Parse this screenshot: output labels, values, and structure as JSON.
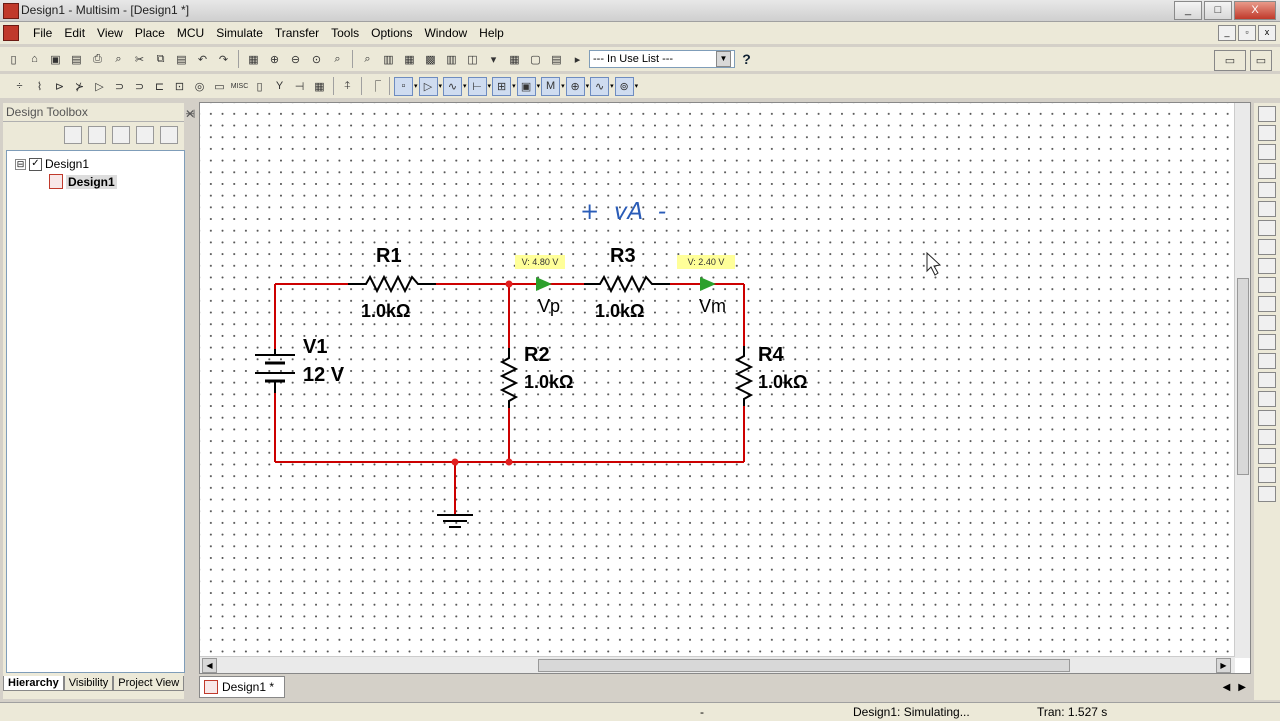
{
  "window": {
    "title": "Design1 - Multisim - [Design1 *]",
    "buttons": [
      "_",
      "□",
      "X"
    ]
  },
  "menu": {
    "items": [
      "File",
      "Edit",
      "View",
      "Place",
      "MCU",
      "Simulate",
      "Transfer",
      "Tools",
      "Options",
      "Window",
      "Help"
    ]
  },
  "toolbar": {
    "in_use_list": "--- In Use List ---",
    "help_symbol": "?",
    "misc_label": "MISC"
  },
  "toolbox": {
    "title": "Design Toolbox",
    "tree": [
      {
        "label": "Design1",
        "expand": "⊟",
        "checked": "✓"
      },
      {
        "label": "Design1",
        "selected": true
      }
    ],
    "tabs": [
      "Hierarchy",
      "Visibility",
      "Project View"
    ]
  },
  "schematic": {
    "annotation": "+  vA  -",
    "components": [
      {
        "ref": "R1",
        "value": "1.0kΩ"
      },
      {
        "ref": "R2",
        "value": "1.0kΩ"
      },
      {
        "ref": "R3",
        "value": "1.0kΩ"
      },
      {
        "ref": "R4",
        "value": "1.0kΩ"
      },
      {
        "ref": "V1",
        "value": "12 V"
      }
    ],
    "probes": [
      {
        "name": "Vp",
        "reading": "V: 4.80 V"
      },
      {
        "name": "Vm",
        "reading": "V: 2.40 V"
      }
    ],
    "colors": {
      "wire": "#cc0000",
      "junction": "#e02020",
      "component": "#000000",
      "probe_arrow": "#2ca02c",
      "probe_tag_bg": "#ffff99",
      "annotation": "#2a5cb8"
    }
  },
  "document_tab": {
    "label": "Design1 *"
  },
  "status": {
    "dash": "-",
    "simulating": "Design1: Simulating...",
    "tran": "Tran: 1.527 s"
  }
}
